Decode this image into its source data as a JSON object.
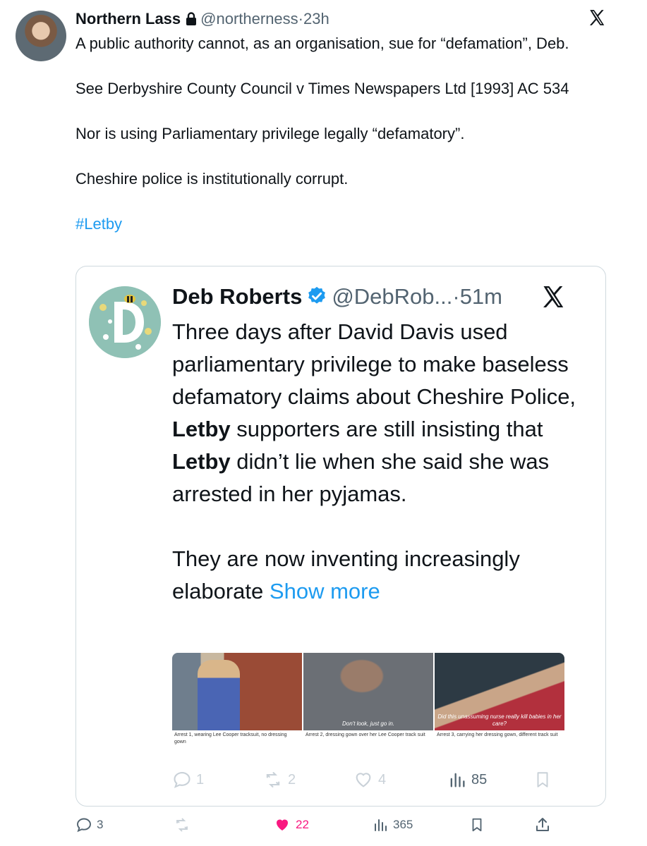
{
  "tweet": {
    "author_name": "Northern Lass",
    "handle": "@northerness",
    "separator": "·",
    "time": "23h",
    "paragraphs": [
      "A public authority cannot, as an organisation, sue for “defamation”, Deb.",
      "See Derbyshire County Council v Times Newspapers Ltd [1993] AC 534",
      "Nor is using Parliamentary privilege legally “defamatory”.",
      "Cheshire police is institutionally corrupt."
    ],
    "hashtag": "#Letby",
    "icons": {
      "lock": "lock-icon",
      "platform": "x-logo-icon"
    }
  },
  "quote": {
    "author_name": "Deb Roberts",
    "handle": "@DebRob...",
    "separator": "·",
    "time": "51m",
    "p1": {
      "a": "Three days after David Davis used parliamentary privilege to make baseless defamatory claims about Cheshire Police, ",
      "b": "Letby",
      "c": " supporters are still insisting that ",
      "d": "Letby",
      "e": " didn’t lie when she said she was arrested in her pyjamas."
    },
    "p2": "They are now inventing increasingly elaborate",
    "show_more": "Show more",
    "media": [
      {
        "overlay": "",
        "caption": "Arrest 1, wearing Lee Cooper tracksuit, no dressing gown"
      },
      {
        "overlay": "Don't look, just go in.",
        "caption": "Arrest 2, dressing gown over her Lee Cooper track suit"
      },
      {
        "overlay": "Did this unassuming nurse really kill babies in her care?",
        "caption": "Arrest 3, carrying her dressing gown, different track suit"
      }
    ],
    "actions": {
      "replies": "1",
      "reposts": "2",
      "likes": "4",
      "views": "85"
    }
  },
  "actions": {
    "replies": "3",
    "likes": "22",
    "views": "365"
  },
  "colors": {
    "accent": "#1d9bf0",
    "like": "#f91880",
    "muted": "#536471"
  }
}
